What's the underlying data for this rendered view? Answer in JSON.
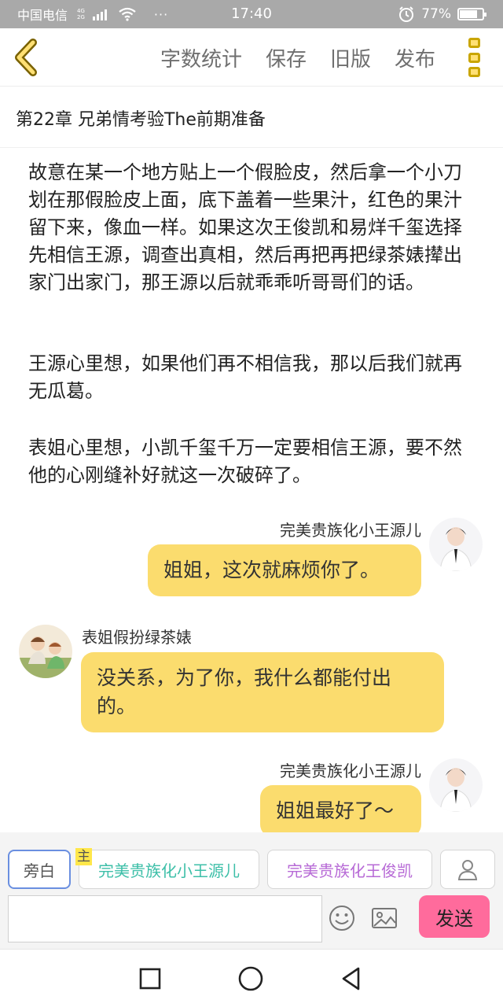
{
  "status_bar": {
    "carrier": "中国电信",
    "network_top": "4G",
    "network_bottom": "2G",
    "dots": "···",
    "time": "17:40",
    "battery": "77%",
    "battery_level": 0.77
  },
  "toolbar": {
    "actions": [
      "字数统计",
      "保存",
      "旧版",
      "发布"
    ]
  },
  "chapter": {
    "title": "第22章  兄弟情考验The前期准备"
  },
  "paragraphs": [
    "故意在某一个地方贴上一个假脸皮，然后拿一个小刀划在那假脸皮上面，底下盖着一些果汁，红色的果汁留下来，像血一样。如果这次王俊凯和易烊千玺选择先相信王源，调查出真相，然后再把再把绿茶婊撵出家门出家门，那王源以后就乖乖听哥哥们的话。",
    "王源心里想，如果他们再不相信我，那以后我们就再无瓜葛。",
    "表姐心里想，小凯千玺千万一定要相信王源，要不然他的心刚缝补好就这一次破碎了。"
  ],
  "messages": [
    {
      "side": "right",
      "name": "完美贵族化小王源儿",
      "text": "姐姐，这次就麻烦你了。"
    },
    {
      "side": "left",
      "name": "表姐假扮绿茶婊",
      "text": "没关系，为了你，我什么都能付出的。"
    },
    {
      "side": "right",
      "name": "完美贵族化小王源儿",
      "text": "姐姐最好了～"
    }
  ],
  "composer": {
    "narration_label": "旁白",
    "main_badge": "主",
    "role_a": "完美贵族化小王源儿",
    "role_b": "完美贵族化王俊凯",
    "input_value": "",
    "send_label": "发送"
  },
  "colors": {
    "bubble": "#fbdc6e",
    "send": "#ff6b9c",
    "role_a": "#3dbfa8",
    "role_b": "#b76ad6",
    "accent": "#ffe074"
  }
}
